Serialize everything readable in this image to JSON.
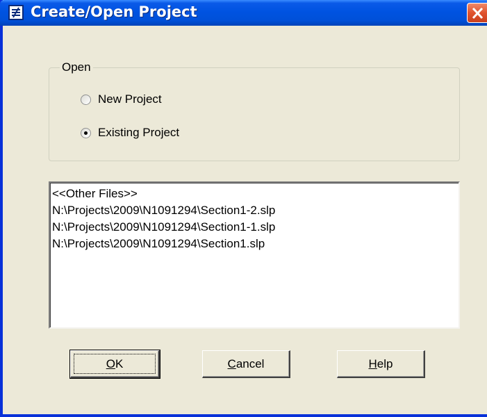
{
  "window": {
    "title": "Create/Open Project",
    "icon": "app-project-icon",
    "close_icon": "close-icon"
  },
  "open_group": {
    "legend": "Open",
    "options": [
      {
        "label": "New Project",
        "selected": false
      },
      {
        "label": "Existing Project",
        "selected": true
      }
    ]
  },
  "file_list": {
    "items": [
      "<<Other Files>>",
      "N:\\Projects\\2009\\N1091294\\Section1-2.slp",
      "N:\\Projects\\2009\\N1091294\\Section1-1.slp",
      "N:\\Projects\\2009\\N1091294\\Section1.slp"
    ]
  },
  "buttons": {
    "ok": {
      "mnemonic": "O",
      "rest": "K"
    },
    "cancel": {
      "mnemonic": "C",
      "rest": "ancel"
    },
    "help": {
      "mnemonic": "H",
      "rest": "elp"
    }
  },
  "colors": {
    "titlebar": "#0053E1",
    "dialog_bg": "#ECE9D8",
    "close_button": "#E0532E"
  }
}
